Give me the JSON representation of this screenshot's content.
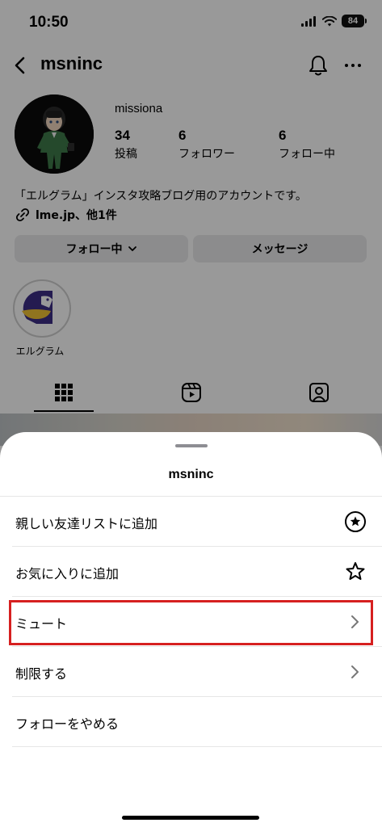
{
  "status_bar": {
    "time": "10:50",
    "battery": "84"
  },
  "header": {
    "username": "msninc"
  },
  "profile": {
    "name": "missiona",
    "stats": [
      {
        "value": "34",
        "label": "投稿"
      },
      {
        "value": "6",
        "label": "フォロワー"
      },
      {
        "value": "6",
        "label": "フォロー中"
      }
    ],
    "bio": "「エルグラム」インスタ攻略ブログ用のアカウントです。",
    "link": "lme.jp、他1件",
    "following_button": "フォロー中",
    "message_button": "メッセージ"
  },
  "highlights": [
    {
      "label": "エルグラム"
    }
  ],
  "sheet": {
    "title": "msninc",
    "items": [
      {
        "label": "親しい友達リストに追加",
        "icon": "star-circle-icon"
      },
      {
        "label": "お気に入りに追加",
        "icon": "star-outline-icon"
      },
      {
        "label": "ミュート",
        "icon": "chevron-right-icon",
        "highlighted": true
      },
      {
        "label": "制限する",
        "icon": "chevron-right-icon"
      },
      {
        "label": "フォローをやめる",
        "icon": ""
      }
    ]
  },
  "colors": {
    "highlight_border": "#d62020",
    "sheet_bg": "#ffffff",
    "dim_overlay": "rgba(0,0,0,0.40)"
  }
}
